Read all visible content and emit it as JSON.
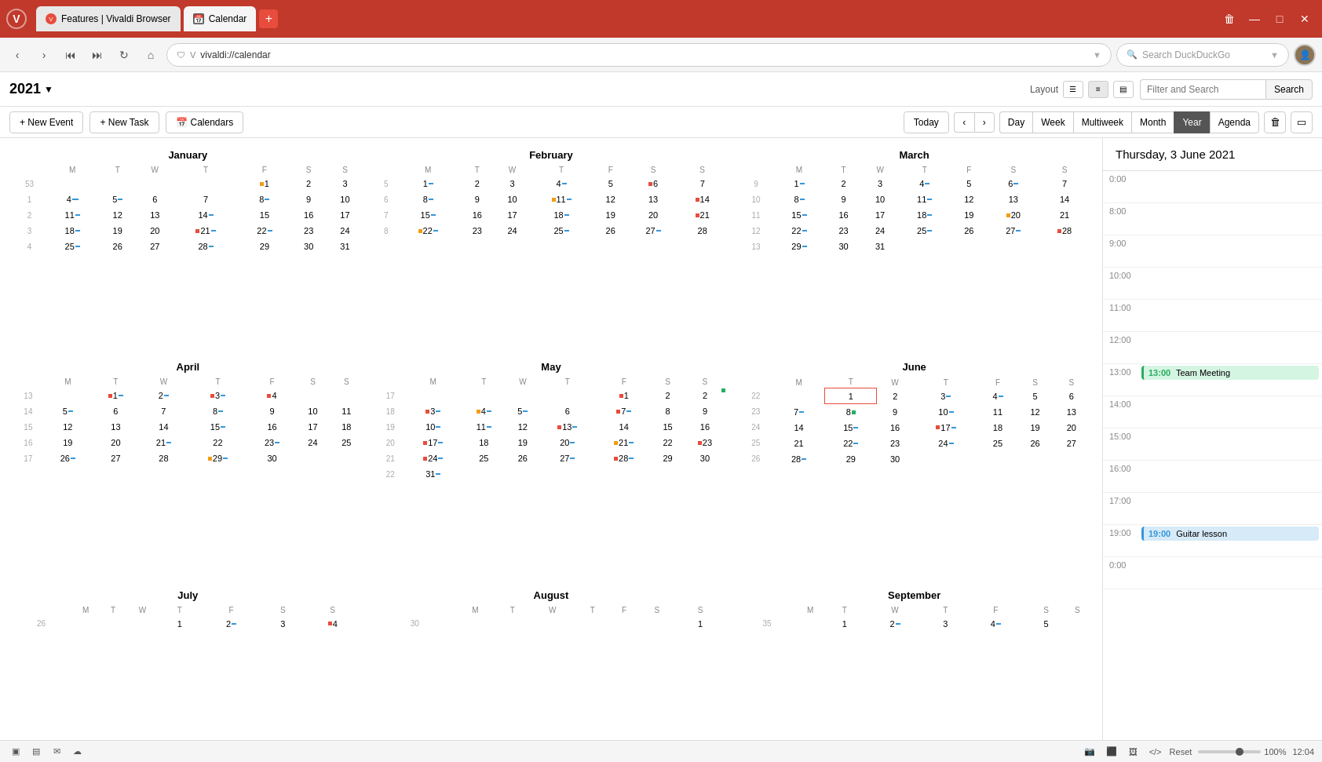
{
  "browser": {
    "tabs": [
      {
        "id": "tab-features",
        "label": "Features | Vivaldi Browser",
        "icon": "V",
        "active": false
      },
      {
        "id": "tab-calendar",
        "label": "Calendar",
        "icon": "📅",
        "active": true
      }
    ],
    "url": "vivaldi://calendar",
    "search_placeholder": "Search DuckDuckGo"
  },
  "toolbar": {
    "year": "2021",
    "layout_label": "Layout",
    "filter_placeholder": "Filter and Search",
    "search_label": "Search"
  },
  "actions": {
    "new_event": "+ New Event",
    "new_task": "+ New Task",
    "calendars": "Calendars",
    "today": "Today",
    "views": [
      "Day",
      "Week",
      "Multiweek",
      "Month",
      "Year",
      "Agenda"
    ],
    "active_view": "Year"
  },
  "right_panel": {
    "date": "Thursday, 3 June 2021",
    "events": [
      {
        "time": "13:00",
        "title": "Team Meeting",
        "type": "green"
      },
      {
        "time": "19:00",
        "title": "Guitar lesson",
        "type": "blue"
      }
    ]
  },
  "months": [
    {
      "name": "January",
      "weekdays": [
        "M",
        "T",
        "W",
        "T",
        "F",
        "S",
        "S"
      ],
      "weeks": [
        {
          "num": "53",
          "days": [
            "",
            "",
            "",
            "",
            "1",
            "2",
            "3"
          ]
        },
        {
          "num": "1",
          "days": [
            "4",
            "5",
            "6",
            "7",
            "8",
            "9",
            "10"
          ]
        },
        {
          "num": "2",
          "days": [
            "11",
            "12",
            "13",
            "14",
            "15",
            "16",
            "17"
          ]
        },
        {
          "num": "3",
          "days": [
            "18",
            "19",
            "20",
            "21",
            "22",
            "23",
            "24"
          ]
        },
        {
          "num": "4",
          "days": [
            "25",
            "26",
            "27",
            "28",
            "29",
            "30",
            "31"
          ]
        }
      ]
    },
    {
      "name": "February",
      "weekdays": [
        "M",
        "T",
        "W",
        "T",
        "F",
        "S",
        "S"
      ],
      "weeks": [
        {
          "num": "5",
          "days": [
            "1",
            "2",
            "3",
            "4",
            "5",
            "6",
            "7"
          ]
        },
        {
          "num": "6",
          "days": [
            "8",
            "9",
            "10",
            "11",
            "12",
            "13",
            "14"
          ]
        },
        {
          "num": "7",
          "days": [
            "15",
            "16",
            "17",
            "18",
            "19",
            "20",
            "21"
          ]
        },
        {
          "num": "8",
          "days": [
            "22",
            "23",
            "24",
            "25",
            "26",
            "27",
            "28"
          ]
        }
      ]
    },
    {
      "name": "March",
      "weekdays": [
        "M",
        "T",
        "W",
        "T",
        "F",
        "S",
        "S"
      ],
      "weeks": [
        {
          "num": "9",
          "days": [
            "1",
            "2",
            "3",
            "4",
            "5",
            "6",
            "7"
          ]
        },
        {
          "num": "10",
          "days": [
            "8",
            "9",
            "10",
            "11",
            "12",
            "13",
            "14"
          ]
        },
        {
          "num": "11",
          "days": [
            "15",
            "16",
            "17",
            "18",
            "19",
            "20",
            "21"
          ]
        },
        {
          "num": "12",
          "days": [
            "22",
            "23",
            "24",
            "25",
            "26",
            "27",
            "28"
          ]
        },
        {
          "num": "13",
          "days": [
            "29",
            "30",
            "31",
            "",
            "",
            "",
            ""
          ]
        }
      ]
    },
    {
      "name": "April",
      "weekdays": [
        "M",
        "T",
        "W",
        "T",
        "F",
        "S",
        "S"
      ],
      "weeks": [
        {
          "num": "13",
          "days": [
            "",
            "1",
            "2",
            "3",
            "4",
            "",
            ""
          ]
        },
        {
          "num": "14",
          "days": [
            "5",
            "6",
            "7",
            "8",
            "9",
            "10",
            "11"
          ]
        },
        {
          "num": "15",
          "days": [
            "12",
            "13",
            "14",
            "15",
            "16",
            "17",
            "18"
          ]
        },
        {
          "num": "16",
          "days": [
            "19",
            "20",
            "21",
            "22",
            "23",
            "24",
            "25"
          ]
        },
        {
          "num": "17",
          "days": [
            "26",
            "27",
            "28",
            "29",
            "30",
            "",
            ""
          ]
        }
      ]
    },
    {
      "name": "May",
      "weekdays": [
        "M",
        "T",
        "W",
        "T",
        "F",
        "S",
        "S"
      ],
      "weeks": [
        {
          "num": "17",
          "days": [
            "",
            "",
            "",
            "",
            "",
            "1",
            "2"
          ]
        },
        {
          "num": "18",
          "days": [
            "3",
            "4",
            "5",
            "6",
            "7",
            "8",
            "9"
          ]
        },
        {
          "num": "19",
          "days": [
            "10",
            "11",
            "12",
            "13",
            "14",
            "15",
            "16"
          ]
        },
        {
          "num": "20",
          "days": [
            "17",
            "18",
            "19",
            "20",
            "21",
            "22",
            "23"
          ]
        },
        {
          "num": "21",
          "days": [
            "24",
            "25",
            "26",
            "27",
            "28",
            "29",
            "30"
          ]
        },
        {
          "num": "22",
          "days": [
            "31",
            "",
            "",
            "",
            "",
            "",
            ""
          ]
        }
      ]
    },
    {
      "name": "June",
      "weekdays": [
        "M",
        "T",
        "W",
        "T",
        "F",
        "S",
        "S"
      ],
      "weeks": [
        {
          "num": "22",
          "days": [
            "",
            "1",
            "2",
            "3",
            "4",
            "5",
            "6"
          ]
        },
        {
          "num": "23",
          "days": [
            "7",
            "8",
            "9",
            "10",
            "11",
            "12",
            "13"
          ]
        },
        {
          "num": "24",
          "days": [
            "14",
            "15",
            "16",
            "17",
            "18",
            "19",
            "20"
          ]
        },
        {
          "num": "25",
          "days": [
            "21",
            "22",
            "23",
            "24",
            "25",
            "26",
            "27"
          ]
        },
        {
          "num": "26",
          "days": [
            "28",
            "29",
            "30",
            "",
            "",
            "",
            ""
          ]
        }
      ]
    },
    {
      "name": "July",
      "weekdays": [
        "M",
        "T",
        "W",
        "T",
        "F",
        "S",
        "S"
      ],
      "weeks": [
        {
          "num": "26",
          "days": [
            "",
            "",
            "",
            "1",
            "2",
            "3",
            "4"
          ]
        }
      ]
    },
    {
      "name": "August",
      "weekdays": [
        "M",
        "T",
        "W",
        "T",
        "F",
        "S",
        "S"
      ],
      "weeks": [
        {
          "num": "30",
          "days": [
            "",
            "",
            "",
            "",
            "",
            "",
            "1"
          ]
        }
      ]
    },
    {
      "name": "September",
      "weekdays": [
        "M",
        "T",
        "W",
        "T",
        "F",
        "S",
        "S"
      ],
      "weeks": [
        {
          "num": "35",
          "days": [
            "",
            "1",
            "2",
            "3",
            "4",
            "5",
            ""
          ]
        }
      ]
    }
  ],
  "time_slots": [
    "0:00",
    "",
    "",
    "",
    "",
    "",
    "",
    "",
    "8:00",
    "",
    "9:00",
    "",
    "10:00",
    "",
    "11:00",
    "",
    "12:00",
    "",
    "13:00",
    "",
    "14:00",
    "",
    "15:00",
    "",
    "16:00",
    "",
    "17:00",
    "",
    "",
    "",
    "19:00",
    "",
    "0:00"
  ],
  "status_bar": {
    "reset_label": "Reset",
    "zoom": "100%",
    "time": "12:04"
  }
}
